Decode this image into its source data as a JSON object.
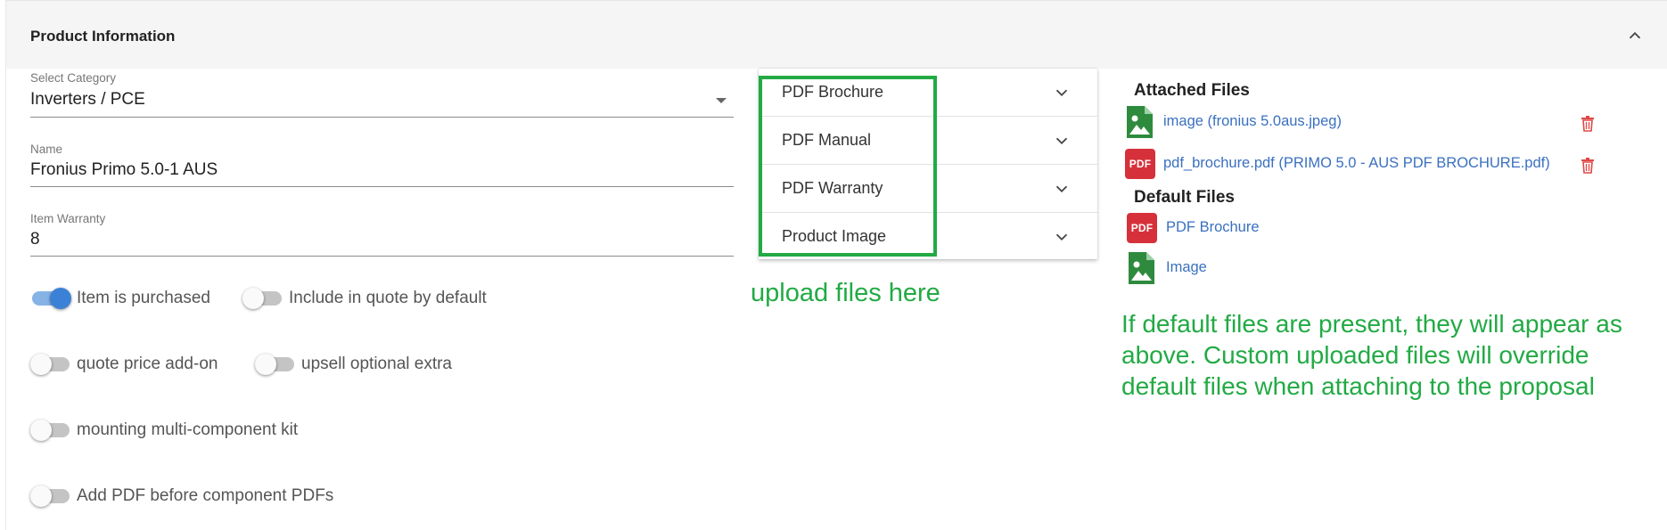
{
  "header": {
    "title": "Product Information",
    "collapse_icon": "chevron-up-icon"
  },
  "form": {
    "category": {
      "label": "Select Category",
      "value": "Inverters / PCE"
    },
    "name": {
      "label": "Name",
      "value": "Fronius Primo 5.0-1 AUS"
    },
    "warranty": {
      "label": "Item Warranty",
      "value": "8"
    }
  },
  "toggles": [
    {
      "label": "Item is purchased",
      "on": true
    },
    {
      "label": "Include in quote by default",
      "on": false
    },
    {
      "label": "quote price add-on",
      "on": false
    },
    {
      "label": "upsell optional extra",
      "on": false
    },
    {
      "label": "mounting multi-component kit",
      "on": false
    },
    {
      "label": "Add PDF before component PDFs",
      "on": false
    }
  ],
  "uploads": [
    {
      "label": "PDF Brochure"
    },
    {
      "label": "PDF Manual"
    },
    {
      "label": "PDF Warranty"
    },
    {
      "label": "Product Image"
    }
  ],
  "attached": {
    "title": "Attached Files",
    "files": [
      {
        "type": "image",
        "name": "image (fronius 5.0aus.jpeg)"
      },
      {
        "type": "pdf",
        "icon_text": "PDF",
        "name": "pdf_brochure.pdf (PRIMO 5.0 - AUS PDF BROCHURE.pdf)"
      }
    ]
  },
  "defaults": {
    "title": "Default Files",
    "files": [
      {
        "type": "pdf",
        "icon_text": "PDF",
        "name": "PDF Brochure"
      },
      {
        "type": "image",
        "name": "Image"
      }
    ]
  },
  "annotations": {
    "upload": "upload files here",
    "default_note": "If default files are present, they will appear as above. Custom uploaded files will override default files when attaching to the proposal"
  },
  "colors": {
    "accent_blue": "#3b82d6",
    "annotation_green": "#22aa44",
    "pdf_red": "#d6313a",
    "image_green": "#2e8b3e",
    "link_blue": "#3a70c0"
  }
}
